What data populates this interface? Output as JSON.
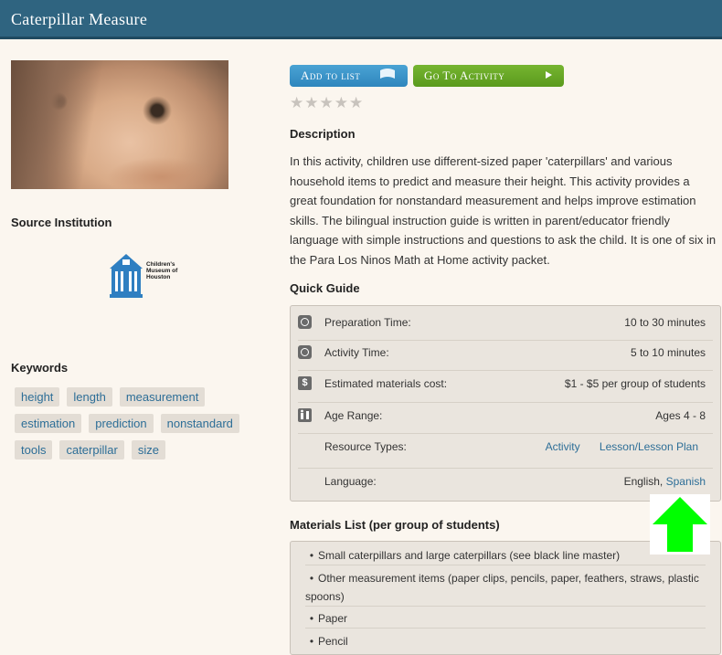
{
  "header": {
    "title": "Caterpillar Measure"
  },
  "left": {
    "source_heading": "Source Institution",
    "logo_text": "Children's Museum of Houston",
    "keywords_heading": "Keywords",
    "keywords": [
      [
        "height",
        "length",
        "measurement"
      ],
      [
        "estimation",
        "prediction",
        "nonstandard"
      ],
      [
        "tools",
        "caterpillar",
        "size"
      ]
    ]
  },
  "actions": {
    "add_label": "Add to list",
    "go_label": "Go To Activity",
    "add_icon": "list-icon",
    "go_icon": "play-arrow-icon",
    "rating": 0,
    "rating_max": 5
  },
  "description": {
    "heading": "Description",
    "text": "In this activity, children use different-sized paper 'caterpillars' and various household items to predict and measure their height. This activity provides a great foundation for nonstandard measurement and helps improve estimation skills. The bilingual instruction guide is written in parent/educator friendly language with simple instructions and questions to ask the child. It is one of six in the Para Los Ninos Math at Home activity packet."
  },
  "quick_guide": {
    "heading": "Quick Guide",
    "prep_label": "Preparation Time:",
    "prep_value": "10 to 30 minutes",
    "activity_label": "Activity Time:",
    "activity_value": "5 to 10 minutes",
    "cost_label": "Estimated materials cost:",
    "cost_value": "$1 - $5 per group of students",
    "cost_icon": "$",
    "age_label": "Age Range:",
    "age_value": "Ages 4 - 8",
    "resource_label": "Resource Types:",
    "resource_types": [
      "Activity",
      "Lesson/Lesson Plan"
    ],
    "language_label": "Language:",
    "language_english": "English,",
    "language_spanish": "Spanish"
  },
  "materials": {
    "heading": "Materials List (per group of students)",
    "items": [
      "Small caterpillars and large caterpillars (see black line master)",
      "Other measurement items (paper clips, pencils, paper, feathers, straws, plastic spoons)",
      "Paper",
      "Pencil"
    ]
  },
  "colors": {
    "header_bg": "#2f6480",
    "add_button": "#2e86bd",
    "go_button": "#5a9a1d",
    "link": "#2d6e97",
    "arrow": "#00ff00"
  }
}
